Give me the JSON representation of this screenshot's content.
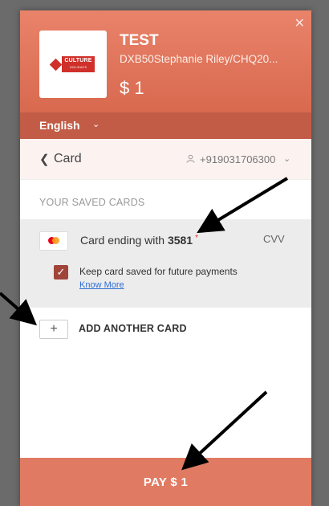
{
  "header": {
    "close_icon": "close-icon",
    "merchant_name": "TEST",
    "merchant_desc": "DXB50Stephanie Riley/CHQ20...",
    "amount": "$ 1",
    "logo": {
      "name": "CULTURE",
      "tagline": "HOLIDAYS"
    },
    "accent_color": "#e07a62"
  },
  "language": {
    "label": "English",
    "chevron": "chevron-down-icon"
  },
  "method": {
    "back_icon": "chevron-left-icon",
    "label": "Card",
    "user_icon": "user-icon",
    "phone": "+919031706300"
  },
  "saved_cards": {
    "title": "YOUR SAVED CARDS",
    "card": {
      "brand_icon": "mastercard-icon",
      "prefix": "Card ending with",
      "last4": "3581",
      "required_mark": "*",
      "cvv_label": "CVV"
    },
    "keep_saved": {
      "label": "Keep card saved for future payments",
      "checked": true,
      "link": "Know More"
    }
  },
  "add_card": {
    "icon": "plus-icon",
    "label": "ADD ANOTHER CARD"
  },
  "pay_button": {
    "label": "PAY $ 1"
  }
}
